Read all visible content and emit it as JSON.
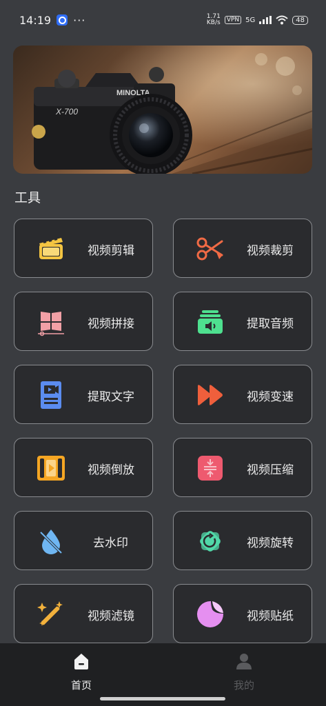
{
  "status": {
    "time": "14:19",
    "more": "···",
    "speed_top": "1.71",
    "speed_unit": "KB/s",
    "vpn": "VPN",
    "net": "5G",
    "battery": "48"
  },
  "banner": {
    "logo_text": "MINOLTA",
    "model_text": "X-700"
  },
  "section_title": "工具",
  "tools": [
    {
      "label": "视频剪辑",
      "icon": "clapperboard-icon",
      "color": "#f4c542"
    },
    {
      "label": "视频裁剪",
      "icon": "scissors-icon",
      "color": "#f06a45"
    },
    {
      "label": "视频拼接",
      "icon": "split-window-icon",
      "color": "#f2a0a6"
    },
    {
      "label": "提取音频",
      "icon": "audio-extract-icon",
      "color": "#4ee08f"
    },
    {
      "label": "提取文字",
      "icon": "text-doc-icon",
      "color": "#5b8cf0"
    },
    {
      "label": "视频变速",
      "icon": "fast-forward-icon",
      "color": "#ef5f3c"
    },
    {
      "label": "视频倒放",
      "icon": "film-play-icon",
      "color": "#f5a623"
    },
    {
      "label": "视频压缩",
      "icon": "compress-icon",
      "color": "#ee5a6f"
    },
    {
      "label": "去水印",
      "icon": "no-water-drop-icon",
      "color": "#6fb6f2"
    },
    {
      "label": "视频旋转",
      "icon": "rotate-icon",
      "color": "#51d7a8"
    },
    {
      "label": "视频滤镜",
      "icon": "magic-wand-icon",
      "color": "#f2b13c"
    },
    {
      "label": "视频贴纸",
      "icon": "sticker-icon",
      "color": "#e58ff0"
    }
  ],
  "tabs": {
    "home": "首页",
    "mine": "我的"
  }
}
